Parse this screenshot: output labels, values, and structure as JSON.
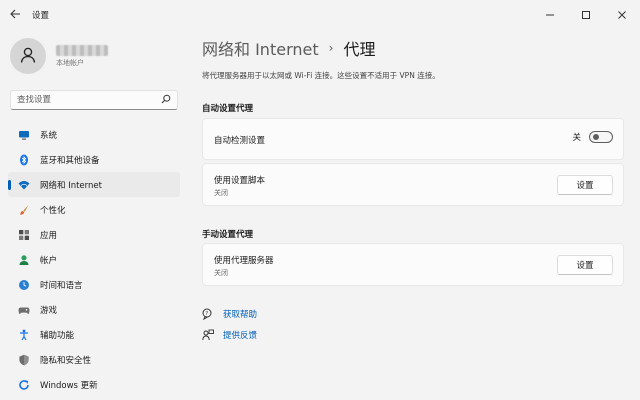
{
  "window": {
    "title": "设置"
  },
  "profile": {
    "subtitle": "本地帐户"
  },
  "search": {
    "placeholder": "查找设置"
  },
  "sidebar": {
    "items": [
      {
        "label": "系统",
        "icon": "monitor-icon"
      },
      {
        "label": "蓝牙和其他设备",
        "icon": "bluetooth-icon"
      },
      {
        "label": "网络和 Internet",
        "icon": "wifi-icon",
        "active": true
      },
      {
        "label": "个性化",
        "icon": "brush-icon"
      },
      {
        "label": "应用",
        "icon": "apps-icon"
      },
      {
        "label": "帐户",
        "icon": "person-icon"
      },
      {
        "label": "时间和语言",
        "icon": "clock-globe-icon"
      },
      {
        "label": "游戏",
        "icon": "gamepad-icon"
      },
      {
        "label": "辅助功能",
        "icon": "accessibility-icon"
      },
      {
        "label": "隐私和安全性",
        "icon": "shield-icon"
      },
      {
        "label": "Windows 更新",
        "icon": "update-icon"
      }
    ]
  },
  "main": {
    "breadcrumb_parent": "网络和 Internet",
    "breadcrumb_separator": "›",
    "breadcrumb_current": "代理",
    "description": "将代理服务器用于以太网或 Wi-Fi 连接。这些设置不适用于 VPN 连接。",
    "auto_section_title": "自动设置代理",
    "auto_detect": {
      "label": "自动检测设置",
      "toggle_state": "关"
    },
    "setup_script": {
      "label": "使用设置脚本",
      "status": "关闭",
      "button": "设置"
    },
    "manual_section_title": "手动设置代理",
    "proxy_server": {
      "label": "使用代理服务器",
      "status": "关闭",
      "button": "设置"
    },
    "links": {
      "help": "获取帮助",
      "feedback": "提供反馈"
    }
  },
  "colors": {
    "accent": "#005fb8",
    "background": "#f3f3f3",
    "card": "#fbfbfb"
  }
}
